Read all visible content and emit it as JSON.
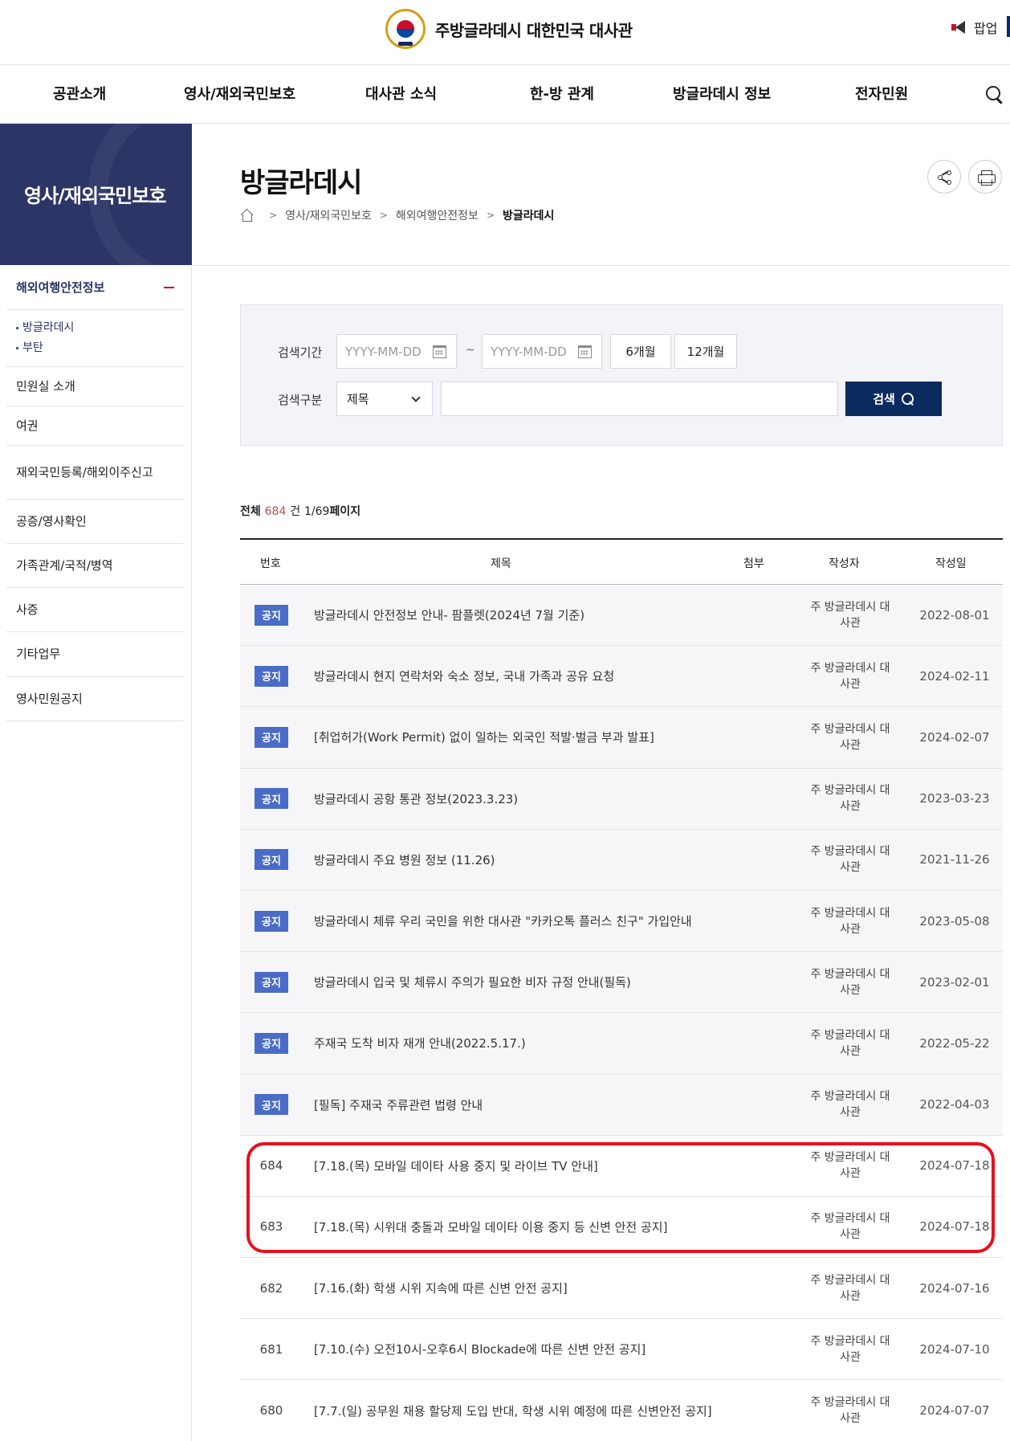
{
  "header": {
    "site_name": "주방글라데시 대한민국 대사관",
    "popup_label": "팝업",
    "nav": [
      "공관소개",
      "영사/재외국민보호",
      "대사관 소식",
      "한-방 관계",
      "방글라데시 정보",
      "전자민원"
    ]
  },
  "sidebar": {
    "hero_title": "영사/재외국민보호",
    "active_group": "해외여행안전정보",
    "sub_items": [
      "방글라데시",
      "부탄"
    ],
    "items": [
      "민원실 소개",
      "여권",
      "재외국민등록/해외이주신고",
      "공증/영사확인",
      "가족관계/국적/병역",
      "사증",
      "기타업무",
      "영사민원공지"
    ]
  },
  "page": {
    "title": "방글라데시",
    "breadcrumb": [
      "영사/재외국민보호",
      "해외여행안전정보",
      "방글라데시"
    ]
  },
  "search": {
    "period_label": "검색기간",
    "start_placeholder": "YYYY-MM-DD",
    "end_placeholder": "YYYY-MM-DD",
    "tilde": "~",
    "btn_6m": "6개월",
    "btn_12m": "12개월",
    "type_label": "검색구분",
    "type_selected": "제목",
    "submit_label": "검색"
  },
  "summary": {
    "prefix": "전체",
    "total": "684",
    "suffix": "건",
    "pages": "1/69",
    "page_word": "페이지"
  },
  "table": {
    "headers": [
      "번호",
      "제목",
      "첨부",
      "작성자",
      "작성일"
    ],
    "rows": [
      {
        "num": "공지",
        "notice": true,
        "title": "방글라데시 안전정보 안내- 팜플렛(2024년 7월 기준)",
        "writer": "주 방글라데시 대사관",
        "date": "2022-08-01"
      },
      {
        "num": "공지",
        "notice": true,
        "title": "방글라데시 현지 연락처와 숙소 정보, 국내 가족과 공유 요청",
        "writer": "주 방글라데시 대사관",
        "date": "2024-02-11"
      },
      {
        "num": "공지",
        "notice": true,
        "title": "[취업허가(Work Permit) 없이 일하는 외국인 적발·벌금 부과 발표]",
        "writer": "주 방글라데시 대사관",
        "date": "2024-02-07"
      },
      {
        "num": "공지",
        "notice": true,
        "title": "방글라데시 공항 통관 정보(2023.3.23)",
        "writer": "주 방글라데시 대사관",
        "date": "2023-03-23"
      },
      {
        "num": "공지",
        "notice": true,
        "title": "방글라데시 주요 병원 정보 (11.26)",
        "writer": "주 방글라데시 대사관",
        "date": "2021-11-26"
      },
      {
        "num": "공지",
        "notice": true,
        "title": "방글라데시 체류 우리 국민을 위한 대사관 \"카카오톡 플러스 친구\" 가입안내",
        "writer": "주 방글라데시 대사관",
        "date": "2023-05-08"
      },
      {
        "num": "공지",
        "notice": true,
        "title": "방글라데시 입국 및 체류시 주의가 필요한 비자 규정 안내(필독)",
        "writer": "주 방글라데시 대사관",
        "date": "2023-02-01"
      },
      {
        "num": "공지",
        "notice": true,
        "title": "주재국 도착 비자 재개 안내(2022.5.17.)",
        "writer": "주 방글라데시 대사관",
        "date": "2022-05-22"
      },
      {
        "num": "공지",
        "notice": true,
        "title": "[필독] 주재국 주류관련 법령 안내",
        "writer": "주 방글라데시 대사관",
        "date": "2022-04-03"
      },
      {
        "num": "684",
        "notice": false,
        "title": "[7.18.(목) 모바일 데이타 사용 중지 및 라이브 TV 안내]",
        "writer": "주 방글라데시 대사관",
        "date": "2024-07-18"
      },
      {
        "num": "683",
        "notice": false,
        "title": "[7.18.(목) 시위대 충돌과 모바일 데이타 이용 중지 등 신변 안전 공지]",
        "writer": "주 방글라데시 대사관",
        "date": "2024-07-18"
      },
      {
        "num": "682",
        "notice": false,
        "title": "[7.16.(화) 학생 시위 지속에 따른 신변 안전 공지]",
        "writer": "주 방글라데시 대사관",
        "date": "2024-07-16"
      },
      {
        "num": "681",
        "notice": false,
        "title": "[7.10.(수) 오전10시-오후6시 Blockade에 따른 신변 안전 공지]",
        "writer": "주 방글라데시 대사관",
        "date": "2024-07-10"
      },
      {
        "num": "680",
        "notice": false,
        "title": "[7.7.(일) 공무원 채용 할당제 도입 반대, 학생 시위 예정에 따른 신변안전 공지]",
        "writer": "주 방글라데시 대사관",
        "date": "2024-07-07"
      }
    ]
  },
  "colors": {
    "navy": "#0b2a5e",
    "sidebar_hero": "#2c3566",
    "notice_badge": "#4a6cc8",
    "highlight": "#e8101c",
    "count_accent": "#b5524e"
  }
}
